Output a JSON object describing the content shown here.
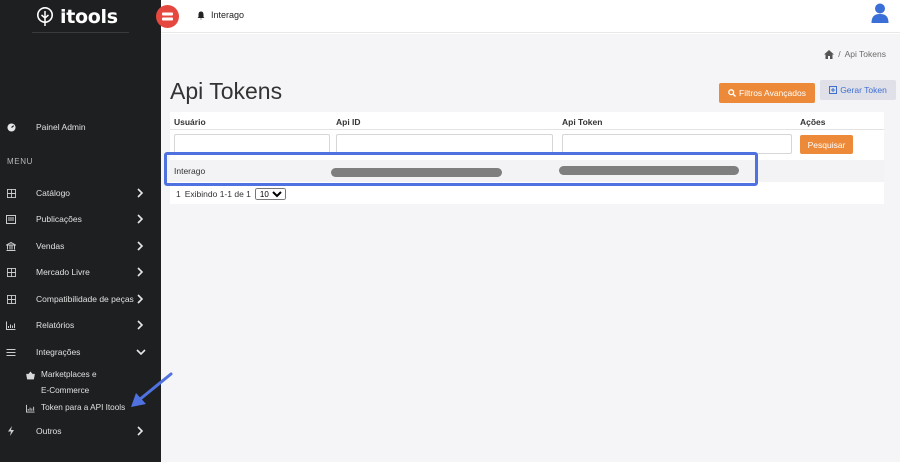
{
  "app": {
    "logo_text": "itools"
  },
  "topbar": {
    "org_name": "Interago"
  },
  "sidebar": {
    "admin_label": "Painel Admin",
    "menu_heading": "MENU",
    "items": [
      {
        "label": "Catálogo"
      },
      {
        "label": "Publicações"
      },
      {
        "label": "Vendas"
      },
      {
        "label": "Mercado Livre"
      },
      {
        "label": "Compatibilidade de peças"
      },
      {
        "label": "Relatórios"
      },
      {
        "label": "Integrações"
      }
    ],
    "subitems": [
      {
        "label_line1": "Marketplaces e",
        "label_line2": "E-Commerce"
      },
      {
        "label": "Token para a API Itools"
      }
    ],
    "last_item": {
      "label": "Outros"
    }
  },
  "breadcrumb": {
    "current": "Api Tokens"
  },
  "page": {
    "title": "Api Tokens",
    "filter_button": "Filtros Avançados",
    "generate_button": "Gerar Token"
  },
  "table": {
    "columns": [
      "Usuário",
      "Api ID",
      "Api Token",
      "Ações"
    ],
    "search_button": "Pesquisar",
    "rows": [
      {
        "usuario": "Interago"
      }
    ],
    "pager": {
      "page": "1",
      "summary": "Exibindo 1-1 de 1",
      "page_size": "10"
    }
  },
  "colors": {
    "sidebar_bg": "#1e1f21",
    "accent_orange": "#ec8a3a",
    "toggle_red": "#e5483f",
    "highlight_blue": "#4f72e0",
    "link_blue": "#3e6fd1"
  }
}
